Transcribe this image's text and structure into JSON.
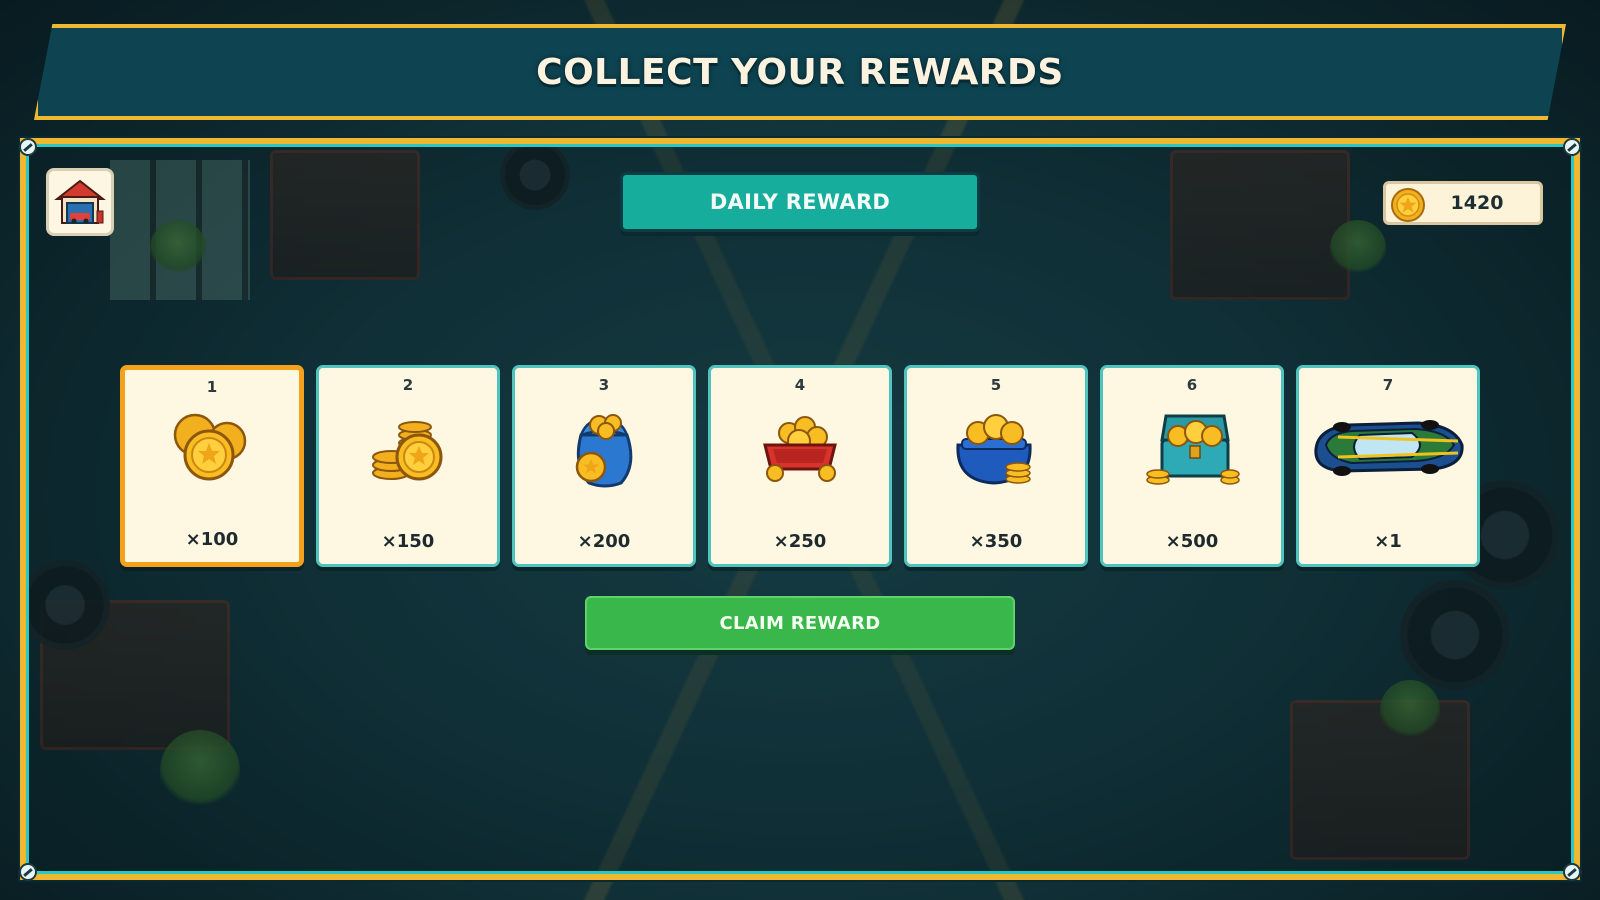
{
  "title": "COLLECT YOUR REWARDS",
  "header": {
    "daily_tab_label": "DAILY REWARD"
  },
  "currency": {
    "coins": "1420",
    "icon": "gold-coin-icon"
  },
  "garage_button": {
    "icon": "garage-icon"
  },
  "rewards": [
    {
      "day": "1",
      "amount": "×100",
      "icon": "coin-pile-icon",
      "active": true
    },
    {
      "day": "2",
      "amount": "×150",
      "icon": "coin-stack-icon",
      "active": false
    },
    {
      "day": "3",
      "amount": "×200",
      "icon": "coin-bag-icon",
      "active": false
    },
    {
      "day": "4",
      "amount": "×250",
      "icon": "coin-tray-icon",
      "active": false
    },
    {
      "day": "5",
      "amount": "×350",
      "icon": "coin-sack-icon",
      "active": false
    },
    {
      "day": "6",
      "amount": "×500",
      "icon": "treasure-chest-icon",
      "active": false
    },
    {
      "day": "7",
      "amount": "×1",
      "icon": "sports-car-icon",
      "active": false
    }
  ],
  "claim_button": {
    "label": "CLAIM REWARD"
  },
  "colors": {
    "banner": "#0e4452",
    "frame_gold": "#f0b830",
    "frame_teal": "#2cc7c0",
    "daily_tab": "#16ad9c",
    "claim_green": "#3ab74b",
    "active_border": "#f4a21e",
    "card_bg": "#fef7e2"
  }
}
